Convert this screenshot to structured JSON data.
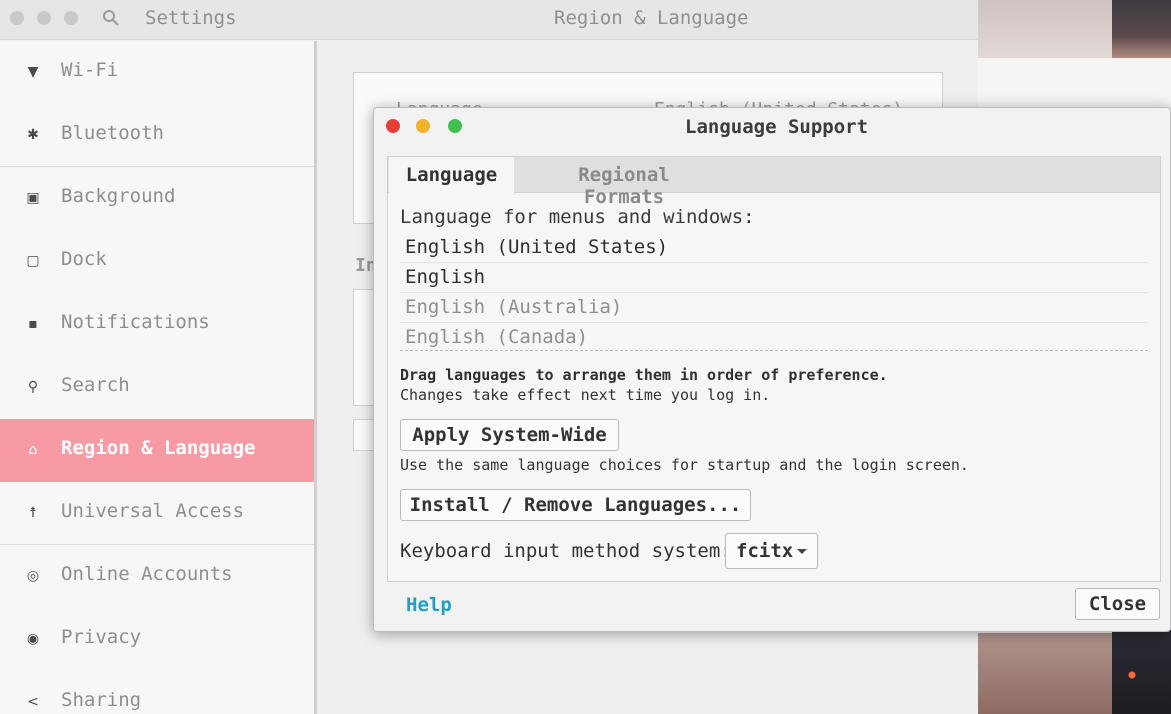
{
  "settings_window": {
    "app_title": "Settings",
    "panel_title": "Region & Language"
  },
  "sidebar": {
    "items": [
      {
        "label": "Wi-Fi",
        "icon": "wifi-icon",
        "glyph": "▼"
      },
      {
        "label": "Bluetooth",
        "icon": "bluetooth-icon",
        "glyph": "✱"
      },
      {
        "label": "Background",
        "icon": "background-icon",
        "glyph": "▣"
      },
      {
        "label": "Dock",
        "icon": "dock-icon",
        "glyph": "▢"
      },
      {
        "label": "Notifications",
        "icon": "notifications-icon",
        "glyph": "▪"
      },
      {
        "label": "Search",
        "icon": "search-icon",
        "glyph": "⚲"
      },
      {
        "label": "Region & Language",
        "icon": "region-language-icon",
        "glyph": "⌂"
      },
      {
        "label": "Universal Access",
        "icon": "universal-access-icon",
        "glyph": "☨"
      },
      {
        "label": "Online Accounts",
        "icon": "online-accounts-icon",
        "glyph": "◎"
      },
      {
        "label": "Privacy",
        "icon": "privacy-icon",
        "glyph": "◉"
      },
      {
        "label": "Sharing",
        "icon": "sharing-icon",
        "glyph": "<"
      }
    ]
  },
  "background_panel": {
    "language_label_partial": "Language",
    "language_value_partial": "English (United States)",
    "section_partial": "In"
  },
  "dialog": {
    "title": "Language Support",
    "tabs": [
      {
        "label": "Language",
        "active": true
      },
      {
        "label": "Regional Formats",
        "active": false
      }
    ],
    "heading": "Language for menus and windows:",
    "languages": [
      {
        "name": "English (United States)",
        "enabled": true
      },
      {
        "name": "English",
        "enabled": true
      },
      {
        "name": "English (Australia)",
        "enabled": false
      },
      {
        "name": "English (Canada)",
        "enabled": false
      }
    ],
    "drag_note": "Drag languages to arrange them in order of preference.",
    "effect_note": "Changes take effect next time you log in.",
    "apply_button": "Apply System-Wide",
    "apply_note": "Use the same language choices for startup and the login screen.",
    "install_button": "Install / Remove Languages...",
    "keyboard_label": "Keyboard input method system:",
    "keyboard_value": "fcitx",
    "help_link": "Help",
    "close_button": "Close"
  },
  "colors": {
    "accent_active": "#f89aa4",
    "link": "#1da0c3",
    "close_light": "#e5403a",
    "minimize_light": "#f0b42a",
    "maximize_light": "#3fc150"
  }
}
